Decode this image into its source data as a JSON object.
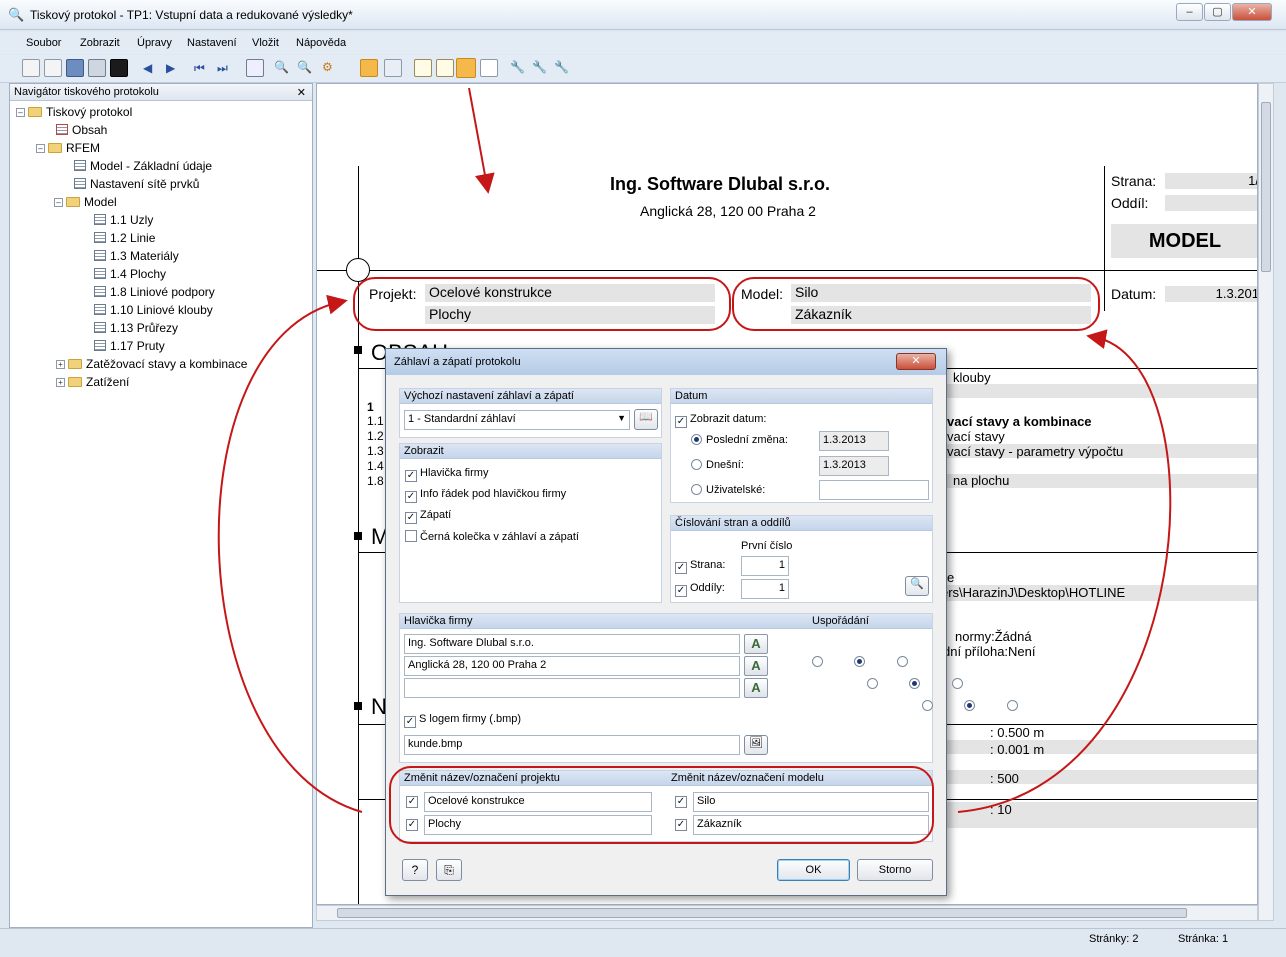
{
  "window": {
    "title": "Tiskový protokol - TP1: Vstupní data a redukované výsledky*",
    "minimize": "–",
    "maximize": "▢",
    "close": "✕"
  },
  "menu": [
    "Soubor",
    "Zobrazit",
    "Úpravy",
    "Nastavení",
    "Vložit",
    "Nápověda"
  ],
  "navigator": {
    "title": "Navigátor tiskového protokolu",
    "close": "✕",
    "items": [
      "Tiskový protokol",
      "Obsah",
      "RFEM",
      "Model - Základní údaje",
      "Nastavení sítě prvků",
      "Model",
      "1.1 Uzly",
      "1.2 Linie",
      "1.3 Materiály",
      "1.4 Plochy",
      "1.8 Liniové podpory",
      "1.10 Liniové klouby",
      "1.13 Průřezy",
      "1.17 Pruty",
      "Zatěžovací stavy a kombinace",
      "Zatížení"
    ]
  },
  "page": {
    "company": "Ing. Software Dlubal s.r.o.",
    "address": "Anglická 28, 120 00 Praha 2",
    "strana_label": "Strana:",
    "strana_value": "1/",
    "oddil_label": "Oddíl:",
    "model_box": "MODEL",
    "projekt_label": "Projekt:",
    "projekt_1": "Ocelové konstrukce",
    "projekt_2": "Plochy",
    "model_label": "Model:",
    "model_1": "Silo",
    "model_2": "Zákazník",
    "datum_label": "Datum:",
    "datum_value": "1.3.201",
    "section_obsah": "OBSAH",
    "section_m": "M",
    "section_n": "N",
    "toc_nums": [
      "1",
      "1.1",
      "1.2",
      "1.3",
      "1.4",
      "1.8"
    ],
    "toc_right": [
      "klouby",
      "vací stavy a kombinace",
      "vací stavy",
      "vací stavy - parametry výpočtu",
      "na plochu"
    ],
    "mid_right": [
      "e",
      "ers\\HarazinJ\\Desktop\\HOTLINE",
      "normy:Žádná",
      "dní příloha:Není"
    ],
    "vals": [
      ": 0.500 m",
      ": 0.001 m",
      ": 500",
      ": 10"
    ]
  },
  "dialog": {
    "title": "Záhlaví a zápatí protokolu",
    "close": "✕",
    "default_group": "Výchozí nastavení záhlaví a zápatí",
    "default_value": "1 - Standardní záhlaví",
    "display_group": "Zobrazit",
    "display_items": [
      "Hlavička firmy",
      "Info řádek pod hlavičkou firmy",
      "Zápatí",
      "Černá kolečka v záhlaví a zápatí"
    ],
    "date_group": "Datum",
    "show_date": "Zobrazit datum:",
    "last_change": "Poslední změna:",
    "last_change_value": "1.3.2013",
    "today": "Dnešní:",
    "today_value": "1.3.2013",
    "custom": "Uživatelské:",
    "numbering_group": "Číslování stran a oddílů",
    "first_number": "První číslo",
    "strana": "Strana:",
    "strana_value": "1",
    "oddily": "Oddíly:",
    "oddily_value": "1",
    "company_group": "Hlavička firmy",
    "company_lines": [
      "Ing. Software Dlubal s.r.o.",
      "Anglická 28, 120 00 Praha 2",
      ""
    ],
    "layout_label": "Uspořádání",
    "logo_check": "S logem firmy (.bmp)",
    "logo_file": "kunde.bmp",
    "project_group": "Změnit název/označení projektu",
    "project_values": [
      "Ocelové konstrukce",
      "Plochy"
    ],
    "model_group": "Změnit název/označení modelu",
    "model_values": [
      "Silo",
      "Zákazník"
    ],
    "ok": "OK",
    "cancel": "Storno",
    "check": "✓",
    "font_glyph": "A"
  },
  "status": {
    "pages": "Stránky: 2",
    "page": "Stránka: 1"
  },
  "colors": {
    "annotation": "#c51717",
    "toolbar_active": "#f5b94b"
  }
}
